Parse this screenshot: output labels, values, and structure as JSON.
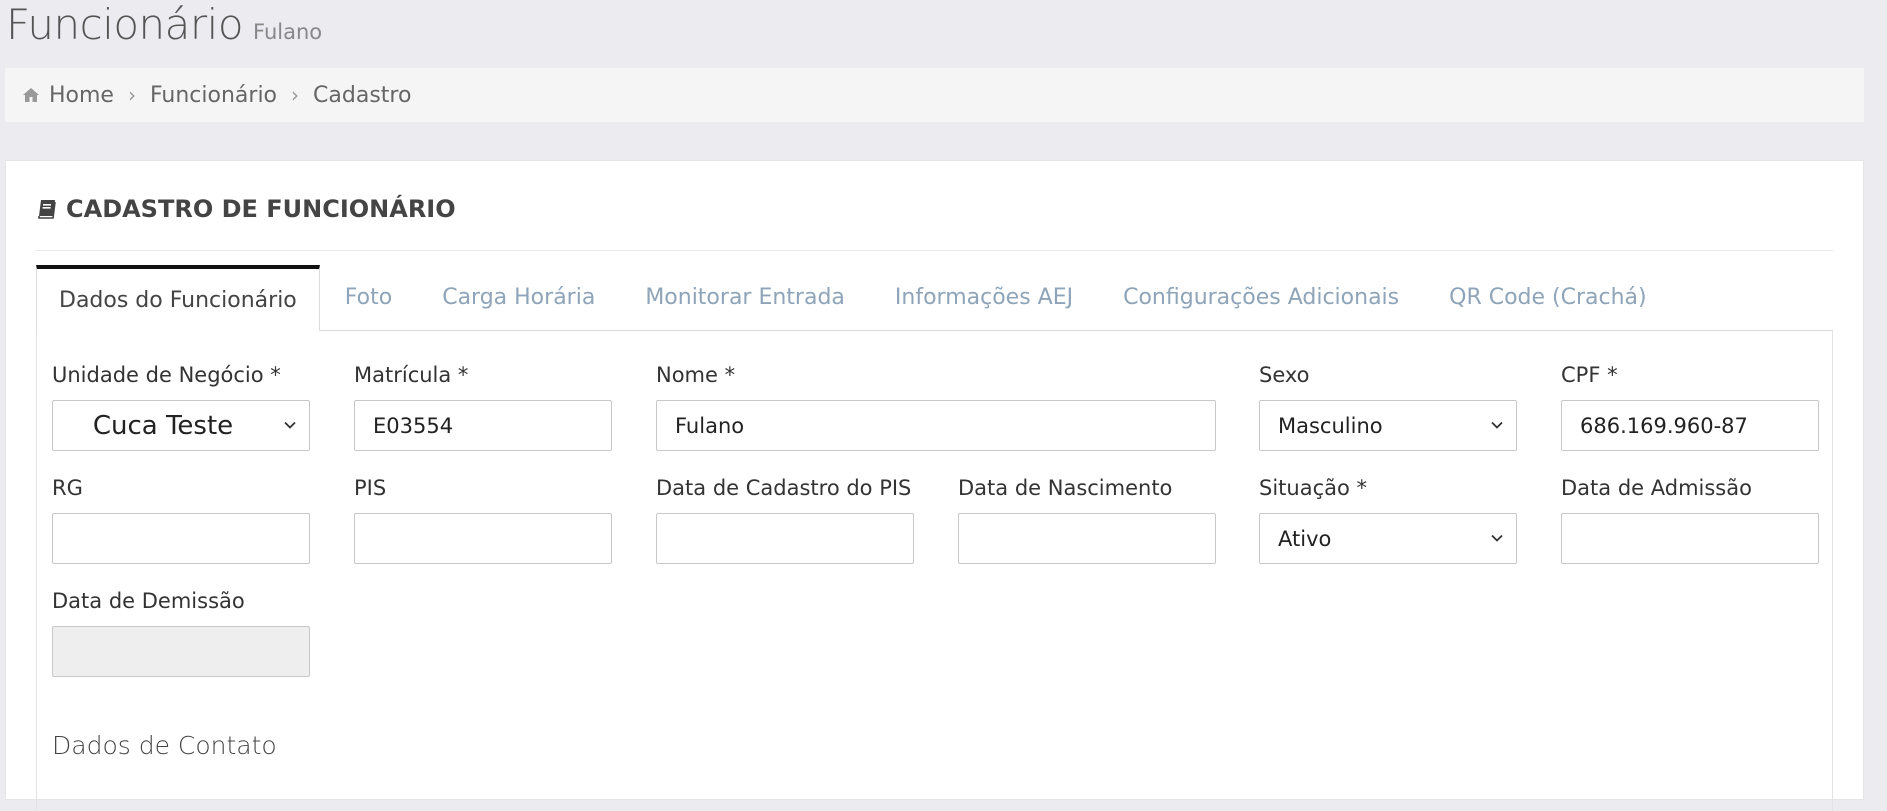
{
  "header": {
    "title": "Funcionário",
    "subtitle": "Fulano"
  },
  "breadcrumb": {
    "home_icon": "home-icon",
    "items": [
      "Home",
      "Funcionário",
      "Cadastro"
    ],
    "separator": "›"
  },
  "panel": {
    "icon": "book-icon",
    "title": "CADASTRO DE FUNCIONÁRIO"
  },
  "tabs": [
    {
      "label": "Dados do Funcionário",
      "active": true
    },
    {
      "label": "Foto"
    },
    {
      "label": "Carga Horária"
    },
    {
      "label": "Monitorar Entrada"
    },
    {
      "label": "Informações AEJ"
    },
    {
      "label": "Configurações Adicionais"
    },
    {
      "label": "QR Code (Crachá)"
    }
  ],
  "form": {
    "unidade": {
      "label": "Unidade de Negócio *",
      "value": "Cuca Teste"
    },
    "matricula": {
      "label": "Matrícula *",
      "value": "E03554"
    },
    "nome": {
      "label": "Nome *",
      "value": "Fulano"
    },
    "sexo": {
      "label": "Sexo",
      "value": "Masculino"
    },
    "cpf": {
      "label": "CPF *",
      "value": "686.169.960-87"
    },
    "rg": {
      "label": "RG",
      "value": ""
    },
    "pis": {
      "label": "PIS",
      "value": ""
    },
    "data_cadastro_pis": {
      "label": "Data de Cadastro do PIS",
      "value": ""
    },
    "data_nascimento": {
      "label": "Data de Nascimento",
      "value": ""
    },
    "situacao": {
      "label": "Situação *",
      "value": "Ativo"
    },
    "data_admissao": {
      "label": "Data de Admissão",
      "value": ""
    },
    "data_demissao": {
      "label": "Data de Demissão",
      "value": ""
    }
  },
  "section": {
    "contato_title": "Dados de Contato"
  },
  "colors": {
    "page_bg": "#ebebf0",
    "breadcrumb_bg": "#f5f5f5",
    "tab_inactive": "#8ea4b8",
    "tab_active_border": "#111111",
    "disabled_input_bg": "#eeeeee"
  }
}
